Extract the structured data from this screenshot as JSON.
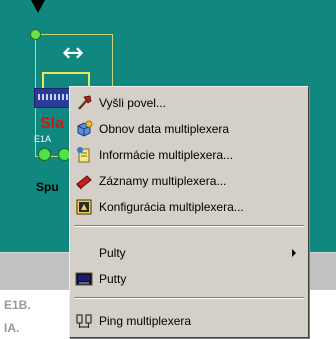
{
  "canvas": {
    "node_label": "Sla",
    "port_label": "E1A",
    "caption": "Spu"
  },
  "lower_area": {
    "line1": "E1B.",
    "line2": "IA."
  },
  "context_menu": {
    "items": [
      {
        "label": "Vyšli povel...",
        "icon": "hammer-icon"
      },
      {
        "label": "Obnov data multiplexera",
        "icon": "refresh-cube-icon"
      },
      {
        "label": "Informácie multiplexera...",
        "icon": "info-scroll-icon"
      },
      {
        "label": "Záznamy multiplexera...",
        "icon": "log-book-icon"
      },
      {
        "label": "Konfigurácia multiplexera...",
        "icon": "config-icon"
      },
      {
        "label": "Pulty",
        "icon": "",
        "has_submenu": true
      },
      {
        "label": "Putty",
        "icon": "terminal-icon"
      },
      {
        "label": "Ping multiplexera",
        "icon": "ping-icon"
      }
    ]
  },
  "colors": {
    "canvas_bg": "#108880",
    "menu_bg": "#d4d0c8",
    "node_label": "#d01818"
  }
}
